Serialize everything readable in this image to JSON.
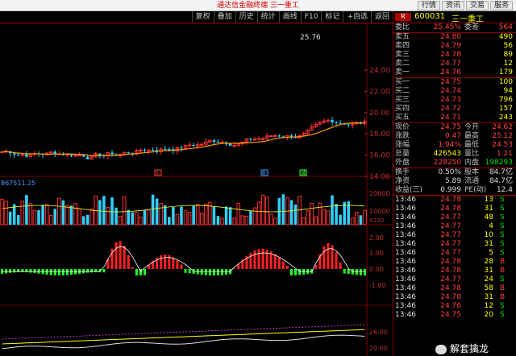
{
  "window": {
    "title": "通达信金融终端  三一重工",
    "top_buttons": [
      "行情",
      "资讯",
      "交易",
      "服务"
    ]
  },
  "toolbar": {
    "buttons": [
      "复权",
      "叠加",
      "历史",
      "统计",
      "画线",
      "F10",
      "标记",
      "+自选",
      "返回"
    ]
  },
  "chart": {
    "max_label": "25.76",
    "price_axis": [
      "24.00",
      "22.00",
      "20.00",
      "18.00",
      "16.00",
      "14.00"
    ],
    "volume_label": "867511.25",
    "volume_axis": [
      "20000",
      "10000",
      "X100"
    ],
    "macd_axis": [
      "2.00",
      "1.00",
      "0.00",
      "-1.00"
    ],
    "bottom_axis": [
      "26.00",
      "20.00"
    ],
    "markers": [
      {
        "text": "S",
        "color": "#ff3030"
      },
      {
        "text": "B",
        "color": "#30a0ff"
      },
      {
        "text": "减",
        "color": "#30ff30"
      }
    ],
    "colors": {
      "up": "#ff3030",
      "down": "#30d0ff",
      "ma": "#ff9900",
      "macd_up": "#ff2020",
      "macd_dn": "#20ff20"
    }
  },
  "stock": {
    "code": "600031",
    "name": "三一重工",
    "flag": "R"
  },
  "order_book": {
    "ratio_label": "委比",
    "ratio_value": "25.45%",
    "diff_label": "委差",
    "diff_value": "564",
    "asks": [
      {
        "label": "卖五",
        "price": "24.80",
        "vol": "490"
      },
      {
        "label": "卖四",
        "price": "24.79",
        "vol": "56"
      },
      {
        "label": "卖三",
        "price": "24.78",
        "vol": "89"
      },
      {
        "label": "卖二",
        "price": "24.77",
        "vol": "12"
      },
      {
        "label": "卖一",
        "price": "24.76",
        "vol": "179"
      }
    ],
    "bids": [
      {
        "label": "买一",
        "price": "24.75",
        "vol": "100"
      },
      {
        "label": "买二",
        "price": "24.74",
        "vol": "94"
      },
      {
        "label": "买三",
        "price": "24.73",
        "vol": "796"
      },
      {
        "label": "买四",
        "price": "24.72",
        "vol": "157"
      },
      {
        "label": "买五",
        "price": "24.71",
        "vol": "243"
      }
    ]
  },
  "quote": [
    {
      "l": "现价",
      "v": "24.75",
      "vc": "red",
      "l2": "今开",
      "v2": "24.62",
      "v2c": "red"
    },
    {
      "l": "涨跌",
      "v": "0.47",
      "vc": "red",
      "l2": "最高",
      "v2": "25.12",
      "v2c": "red"
    },
    {
      "l": "涨幅",
      "v": "1.94%",
      "vc": "red",
      "l2": "最低",
      "v2": "24.53",
      "v2c": "red"
    },
    {
      "l": "总量",
      "v": "426543",
      "vc": "yel",
      "l2": "量比",
      "v2": "1.21",
      "v2c": "red"
    },
    {
      "l": "外盘",
      "v": "228250",
      "vc": "red",
      "l2": "内盘",
      "v2": "198293",
      "v2c": "grn"
    }
  ],
  "fundamentals": [
    {
      "l": "换手",
      "v": "0.50%",
      "vc": "wht",
      "l2": "股本",
      "v2": "84.7亿",
      "v2c": "wht"
    },
    {
      "l": "净资",
      "v": "5.89",
      "vc": "wht",
      "l2": "流通",
      "v2": "84.7亿",
      "v2c": "wht"
    },
    {
      "l": "收益(三)",
      "v": "0.999",
      "vc": "wht",
      "l2": "PE(动)",
      "v2": "12.4",
      "v2c": "wht"
    }
  ],
  "ticks": [
    {
      "t": "13:46",
      "p": "24.78",
      "v": "13",
      "bs": "S"
    },
    {
      "t": "13:46",
      "p": "24.78",
      "v": "31",
      "bs": "S"
    },
    {
      "t": "13:46",
      "p": "24.77",
      "v": "48",
      "bs": "S"
    },
    {
      "t": "13:46",
      "p": "24.77",
      "v": "4",
      "bs": "S"
    },
    {
      "t": "13:46",
      "p": "24.77",
      "v": "10",
      "bs": "S"
    },
    {
      "t": "13:46",
      "p": "24.77",
      "v": "31",
      "bs": "S"
    },
    {
      "t": "13:46",
      "p": "24.77",
      "v": "5",
      "bs": "S"
    },
    {
      "t": "13:46",
      "p": "24.78",
      "v": "28",
      "bs": "B"
    },
    {
      "t": "13:46",
      "p": "24.78",
      "v": "31",
      "bs": "B"
    },
    {
      "t": "13:46",
      "p": "24.77",
      "v": "24",
      "bs": "S"
    },
    {
      "t": "13:46",
      "p": "24.78",
      "v": "58",
      "bs": "B"
    },
    {
      "t": "13:46",
      "p": "24.78",
      "v": "31",
      "bs": "B"
    },
    {
      "t": "13:46",
      "p": "24.76",
      "v": "12",
      "bs": "S"
    },
    {
      "t": "13:46",
      "p": "24.75",
      "v": "20",
      "bs": "S"
    }
  ],
  "watermark": "解套擒龙"
}
